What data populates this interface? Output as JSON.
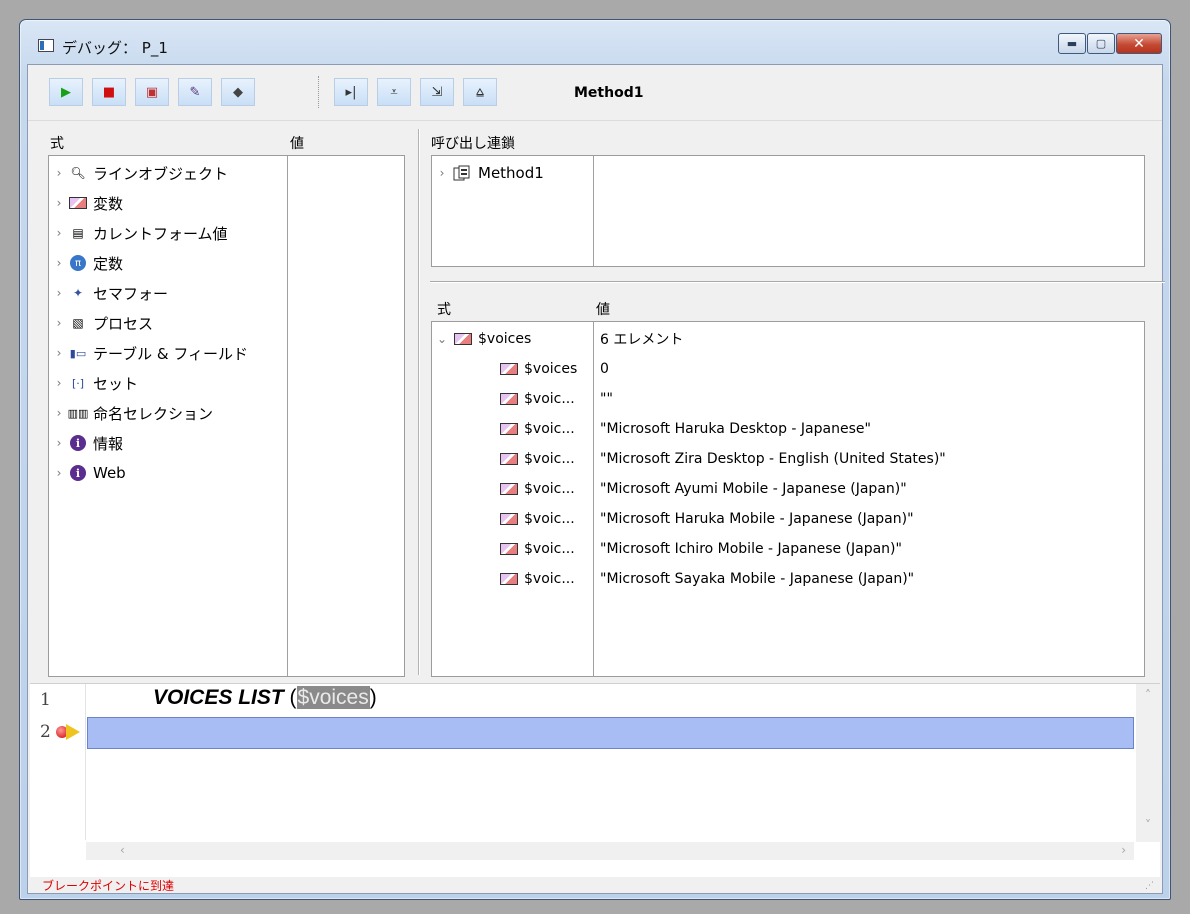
{
  "window": {
    "title": "デバッグ： P_1",
    "controls": {
      "minimize": "▬",
      "maximize": "▢",
      "close": "✕"
    }
  },
  "toolbar": {
    "buttons": [
      {
        "name": "run-button",
        "glyph": "▶",
        "color": "#18a018"
      },
      {
        "name": "abort-button",
        "glyph": "■",
        "color": "#d01010"
      },
      {
        "name": "abort-and-edit-button",
        "glyph": "▣",
        "color": "#c03030"
      },
      {
        "name": "edit-button",
        "glyph": "✎",
        "color": "#553377"
      },
      {
        "name": "disable-breakpoint-button",
        "glyph": "◆",
        "color": "#444"
      },
      {
        "name": "step-over-button",
        "glyph": "▸|",
        "color": "#333"
      },
      {
        "name": "step-into-button",
        "glyph": "⩡",
        "color": "#333"
      },
      {
        "name": "step-into-process-button",
        "glyph": "⇲",
        "color": "#333"
      },
      {
        "name": "step-out-button",
        "glyph": "⩠",
        "color": "#333"
      }
    ],
    "method_name": "Method1"
  },
  "expressions": {
    "col_expr": "式",
    "col_value": "値",
    "items": [
      {
        "label": "ラインオブジェクト",
        "icon": "magnifier-icon"
      },
      {
        "label": "変数",
        "icon": "variable-icon"
      },
      {
        "label": "カレントフォーム値",
        "icon": "form-icon"
      },
      {
        "label": "定数",
        "icon": "constant-icon"
      },
      {
        "label": "セマフォー",
        "icon": "semaphore-icon"
      },
      {
        "label": "プロセス",
        "icon": "process-icon"
      },
      {
        "label": "テーブル & フィールド",
        "icon": "table-icon"
      },
      {
        "label": "セット",
        "icon": "set-icon"
      },
      {
        "label": "命名セレクション",
        "icon": "selection-icon"
      },
      {
        "label": "情報",
        "icon": "info-icon"
      },
      {
        "label": "Web",
        "icon": "info-icon"
      }
    ]
  },
  "call_chain": {
    "label": "呼び出し連鎖",
    "items": [
      {
        "label": "Method1"
      }
    ]
  },
  "watch": {
    "col_expr": "式",
    "col_value": "値",
    "root": {
      "name": "$voices",
      "value": "6 エレメント"
    },
    "children": [
      {
        "name": "$voices",
        "value": "0"
      },
      {
        "name": "$voic...",
        "value": "\"\""
      },
      {
        "name": "$voic...",
        "value": "\"Microsoft Haruka Desktop - Japanese\""
      },
      {
        "name": "$voic...",
        "value": "\"Microsoft Zira Desktop - English (United States)\""
      },
      {
        "name": "$voic...",
        "value": "\"Microsoft Ayumi Mobile - Japanese (Japan)\""
      },
      {
        "name": "$voic...",
        "value": "\"Microsoft Haruka Mobile - Japanese (Japan)\""
      },
      {
        "name": "$voic...",
        "value": "\"Microsoft Ichiro Mobile - Japanese (Japan)\""
      },
      {
        "name": "$voic...",
        "value": "\"Microsoft Sayaka Mobile - Japanese (Japan)\""
      }
    ]
  },
  "editor": {
    "line_numbers": [
      "1",
      "2"
    ],
    "line1_command": "VOICES LIST",
    "line1_open": " (",
    "line1_var": "$voices",
    "line1_close": ")"
  },
  "status": {
    "text": "ブレークポイントに到達"
  }
}
